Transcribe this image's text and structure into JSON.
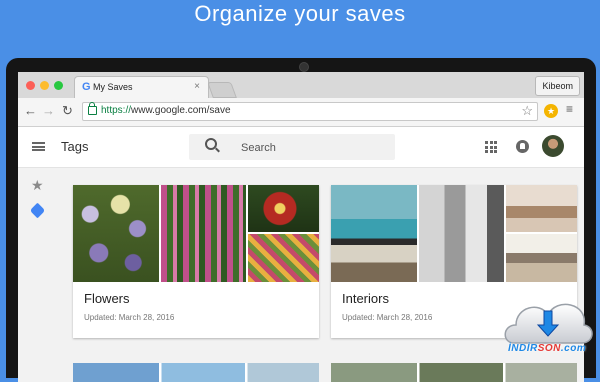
{
  "headline": "Organize your saves",
  "browser": {
    "tab_title": "My Saves",
    "tab_close": "×",
    "profile": "Kibeom",
    "url_scheme": "https://",
    "url_rest": "www.google.com/save",
    "back": "←",
    "forward": "→",
    "reload": "↻",
    "bookmark_star": "☆",
    "menu": "≡"
  },
  "app": {
    "title": "Tags",
    "search_placeholder": "Search",
    "sidebar": {
      "starred_icon": "★"
    }
  },
  "cards": [
    {
      "name": "Flowers",
      "updated": "Updated: March 28, 2016"
    },
    {
      "name": "Interiors",
      "updated": "Updated: March 28, 2016"
    }
  ],
  "watermark": {
    "part1": "İNDİR",
    "part2": "SON",
    "part3": ".com"
  },
  "colors": {
    "background": "#4a8fe6",
    "accent": "#4285f4",
    "secure_green": "#0b8043"
  }
}
